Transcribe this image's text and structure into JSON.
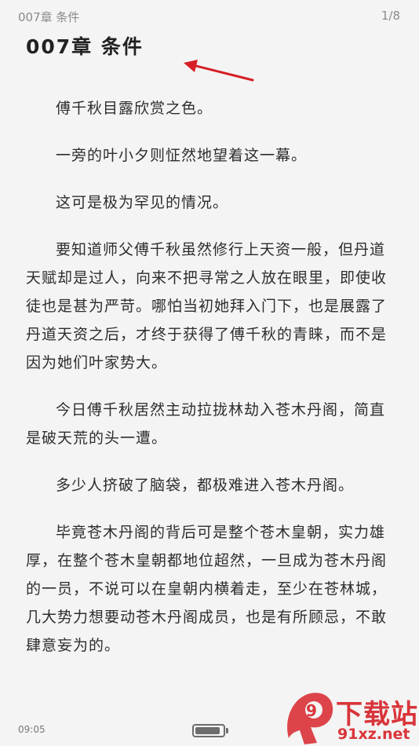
{
  "header": {
    "chapter_short": "007章 条件",
    "page_indicator": "1/8"
  },
  "chapter": {
    "title": "007章 条件"
  },
  "paragraphs": [
    "傅千秋目露欣赏之色。",
    "一旁的叶小夕则怔然地望着这一幕。",
    "这可是极为罕见的情况。",
    "要知道师父傅千秋虽然修行上天资一般，但丹道天赋却是过人，向来不把寻常之人放在眼里，即使收徒也是甚为严苛。哪怕当初她拜入门下，也是展露了丹道天资之后，才终于获得了傅千秋的青睐，而不是因为她们叶家势大。",
    "今日傅千秋居然主动拉拢林劫入苍木丹阁，简直是破天荒的头一遭。",
    "多少人挤破了脑袋，都极难进入苍木丹阁。",
    "毕竟苍木丹阁的背后可是整个苍木皇朝，实力雄厚，在整个苍木皇朝都地位超然，一旦成为苍木丹阁的一员，不说可以在皇朝内横着走，至少在苍林城，几大势力想要动苍木丹阁成员，也是有所顾忌，不敢肆意妄为的。"
  ],
  "footer": {
    "time": "09:05",
    "battery_level": 0.9
  },
  "annotation": {
    "arrow_color": "#d61f26",
    "icon": "red-arrow-pointing-at-title"
  },
  "watermark": {
    "logo_text": "9",
    "cn_text": "下载站",
    "url_text": "91xz.net",
    "color": "#d9343a"
  }
}
